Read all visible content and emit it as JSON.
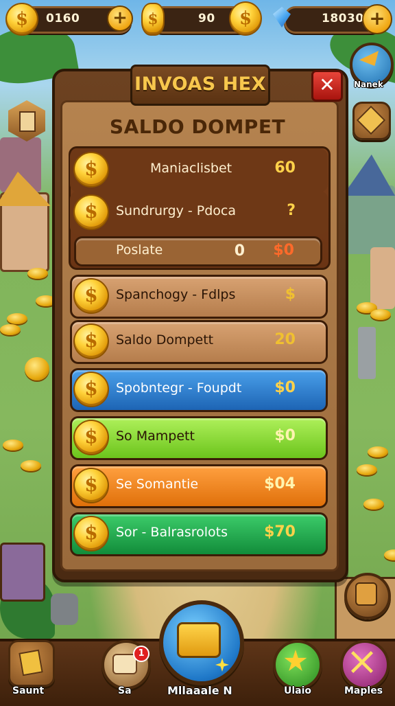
{
  "resources": {
    "coins": "0160",
    "gold": "90",
    "gems": "18030",
    "plus": "+"
  },
  "side": {
    "top_right_label": "Nanek"
  },
  "dialog": {
    "title": "INVOAS HEX",
    "close": "✕",
    "heading": "SALDO DOMPET"
  },
  "rows": [
    {
      "name": "Maniaclisbet",
      "amount": "60"
    },
    {
      "name": "Sundrurgy - Pdoca",
      "amount": "?"
    },
    {
      "name": "Poslate",
      "qty": "0",
      "amount": "$0"
    },
    {
      "name": "Spanchogy - Fdlps",
      "amount": "$"
    },
    {
      "name": "Saldo Dompett",
      "amount": "20"
    },
    {
      "name": "Spobntegr - Foupdt",
      "amount": "$0"
    },
    {
      "name": "So   Mampett",
      "amount": "$0"
    },
    {
      "name": "Se   Somantie",
      "amount": "$04"
    },
    {
      "name": "Sor - Balrasrolots",
      "amount": "$70"
    }
  ],
  "coin_glyph": "$",
  "bottom_nav": [
    {
      "label": "Saunt",
      "icon": "scroll-icon"
    },
    {
      "label": "Sa",
      "icon": "basket-icon",
      "badge": "1"
    },
    {
      "label": "Mllaaale N",
      "icon": "treasure-chest-icon"
    },
    {
      "label": "Ulaio",
      "icon": "star-icon"
    },
    {
      "label": "Maples",
      "icon": "crossed-swords-icon"
    }
  ],
  "colors": {
    "row_brown": "#c69060",
    "row_blue": "#2f7fd0",
    "row_lime": "#8ee03a",
    "row_orange": "#f08a20",
    "row_green": "#22b050",
    "accent_gold": "#f7c74d"
  }
}
